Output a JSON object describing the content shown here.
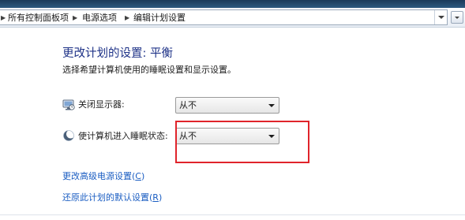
{
  "breadcrumb": {
    "items": [
      {
        "label": "所有控制面板项"
      },
      {
        "label": "电源选项"
      },
      {
        "label": "编辑计划设置"
      }
    ]
  },
  "page": {
    "title": "更改计划的设置: 平衡",
    "subtitle": "选择希望计算机使用的睡眠设置和显示设置。"
  },
  "settings": [
    {
      "label": "关闭显示器:",
      "value": "从不",
      "icon": "monitor-icon"
    },
    {
      "label": "使计算机进入睡眠状态:",
      "value": "从不",
      "icon": "moon-icon"
    }
  ],
  "links": {
    "advanced": {
      "text": "更改高级电源设置(",
      "key": "C",
      "close": ")"
    },
    "restore": {
      "text": "还原此计划的默认设置(",
      "key": "R",
      "close": ")"
    }
  },
  "colors": {
    "title": "#1e3287",
    "link": "#1a5dc2",
    "highlight": "#e0242b"
  }
}
